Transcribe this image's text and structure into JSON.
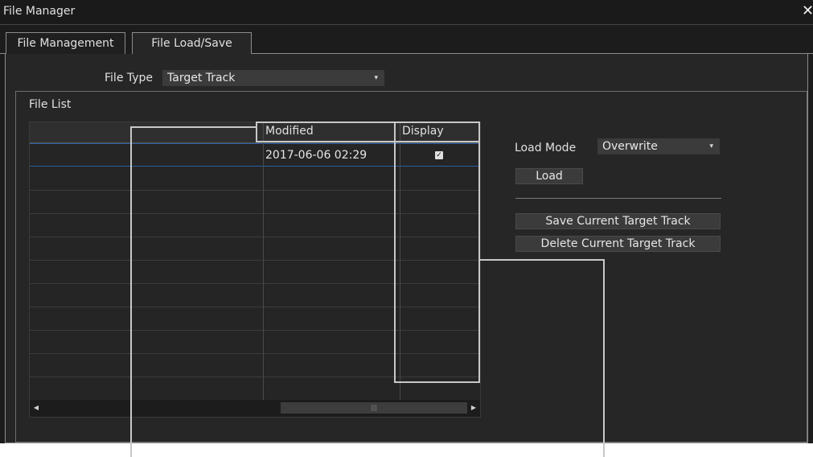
{
  "window": {
    "title": "File Manager",
    "close_glyph": "✕"
  },
  "tabs": [
    {
      "label": "File Management",
      "active": false
    },
    {
      "label": "File Load/Save",
      "active": true
    }
  ],
  "file_type": {
    "label": "File Type",
    "value": "Target Track"
  },
  "file_list": {
    "label": "File List",
    "columns": [
      "",
      "Modified",
      "Display"
    ],
    "rows": [
      {
        "name": "",
        "modified": "2017-06-06 02:29",
        "display": true
      }
    ]
  },
  "load_mode": {
    "label": "Load Mode",
    "value": "Overwrite"
  },
  "buttons": {
    "load": "Load",
    "save_current": "Save Current Target Track",
    "delete_current": "Delete Current Target Track"
  },
  "icons": {
    "close": "close-icon",
    "dropdown": "chevron-down-icon",
    "check": "checkmark-icon",
    "scroll_left": "scroll-left-icon",
    "scroll_right": "scroll-right-icon"
  },
  "colors": {
    "background": "#262626",
    "panel": "#1c1c1c",
    "callout": "#c8c8c8",
    "selection": "#2a5fa5"
  }
}
